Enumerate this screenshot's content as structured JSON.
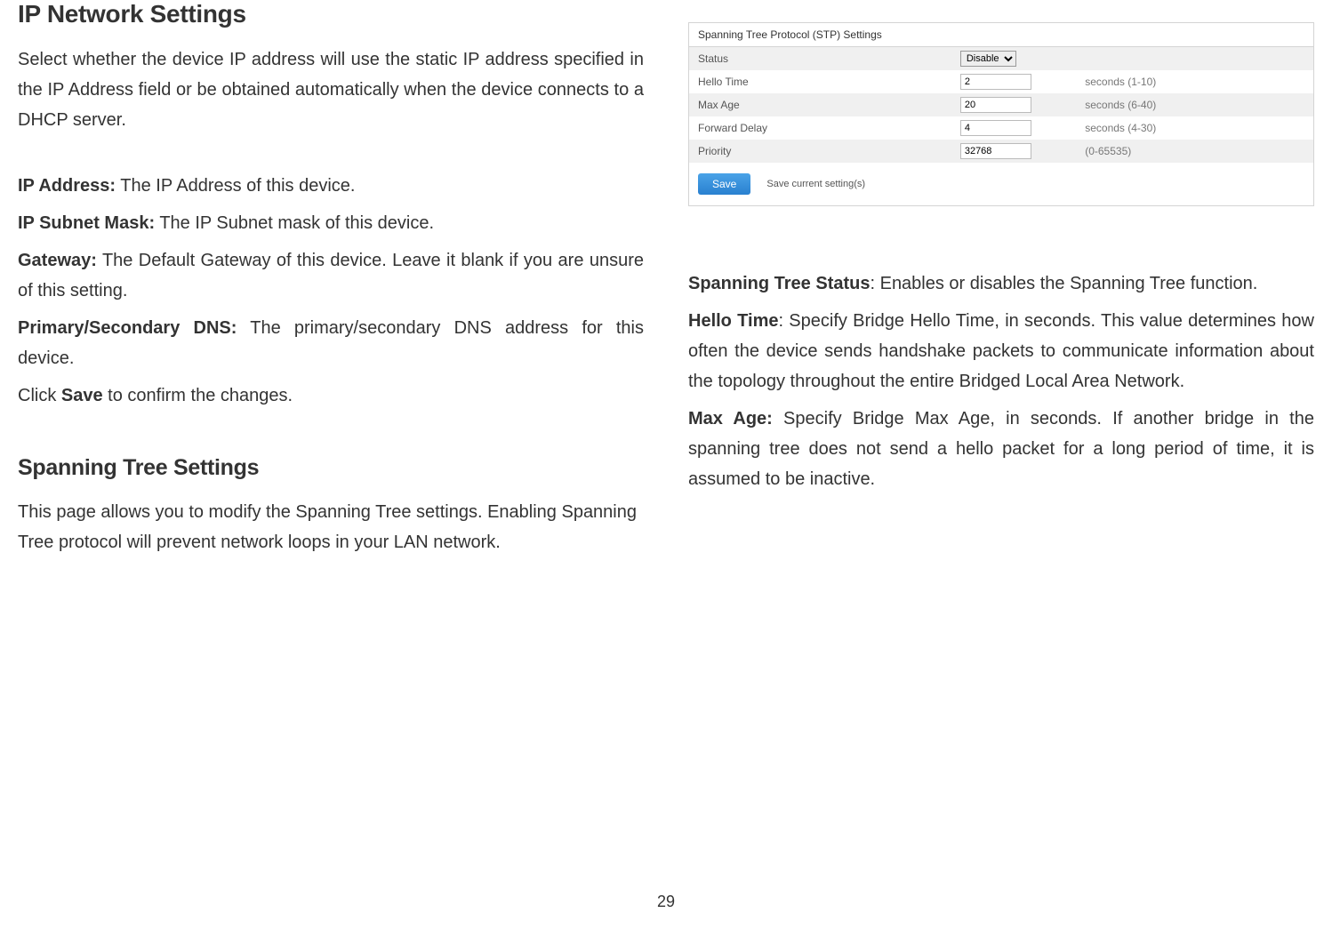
{
  "left": {
    "heading1": "IP Network Settings",
    "intro": "Select whether the device IP address will use the static IP address specified in the IP Address field or be obtained automatically when the device connects to a DHCP server.",
    "ip_address": {
      "label": "IP Address:",
      "text": " The IP Address of this device."
    },
    "subnet": {
      "label": "IP Subnet Mask:",
      "text": " The IP Subnet mask of this device."
    },
    "gateway": {
      "label": "Gateway:",
      "text": " The Default Gateway of this device. Leave it blank if you are unsure of this setting."
    },
    "dns": {
      "label": "Primary/Secondary DNS:",
      "text": " The primary/secondary DNS address for this device."
    },
    "save_line_pre": "Click ",
    "save_line_bold": "Save",
    "save_line_post": " to confirm the changes.",
    "heading2": "Spanning Tree Settings",
    "spanning_intro": "This page allows you to modify the Spanning Tree settings. Enabling Spanning Tree protocol will prevent network loops in your LAN network."
  },
  "panel": {
    "title": "Spanning Tree Protocol (STP) Settings",
    "rows": {
      "status": {
        "label": "Status",
        "value": "Disable"
      },
      "hello": {
        "label": "Hello Time",
        "value": "2",
        "range": "seconds (1-10)"
      },
      "maxage": {
        "label": "Max Age",
        "value": "20",
        "range": "seconds (6-40)"
      },
      "forward": {
        "label": "Forward Delay",
        "value": "4",
        "range": "seconds (4-30)"
      },
      "priority": {
        "label": "Priority",
        "value": "32768",
        "range": "(0-65535)"
      }
    },
    "save_button": "Save",
    "save_hint": "Save current setting(s)"
  },
  "right": {
    "status": {
      "label": "Spanning Tree Status",
      "text": ": Enables or disables the Spanning Tree function."
    },
    "hello": {
      "label": "Hello Time",
      "text": ": Specify Bridge Hello Time, in seconds. This value determines how often the device sends handshake packets to communicate information about the topology throughout the entire Bridged Local Area Network."
    },
    "maxage": {
      "label": "Max Age:",
      "text": " Specify Bridge Max Age, in seconds. If another bridge in the spanning tree does not send a hello packet for a long period of time, it is assumed to be inactive."
    }
  },
  "page_number": "29"
}
